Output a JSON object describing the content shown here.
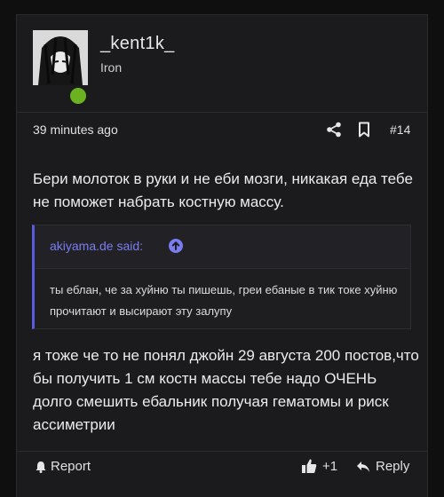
{
  "post": {
    "username": "_kent1k_",
    "user_title": "Iron",
    "timestamp": "39 minutes ago",
    "post_number": "#14",
    "body": "Бери молоток в руки и не еби мозги, никакая еда тебе не поможет набрать костную массу.",
    "quote": {
      "author": "akiyama.de said:",
      "text": "ты еблан, че за хуйню ты пишешь, греи ебаные в тик токе хуйню прочитают и высирают эту залупу"
    },
    "reply_body": "я тоже че то не понял джойн 29 августа 200 постов,что бы получить 1 см костн массы тебе надо ОЧЕНЬ долго смешить ебальник получая гематомы и риск ассиметрии"
  },
  "actions": {
    "report_label": "Report",
    "like_count": "+1",
    "reply_label": "Reply"
  },
  "icons": {
    "share": "share-icon",
    "bookmark": "bookmark-icon",
    "quote_jump": "arrow-up-circle-icon",
    "report": "bell-icon",
    "like": "thumbs-up-icon",
    "reply": "reply-arrow-icon"
  },
  "colors": {
    "background": "#0f0f0f",
    "card": "#1b1b1d",
    "accent": "#7a7cf0",
    "online": "#6ab21f"
  }
}
